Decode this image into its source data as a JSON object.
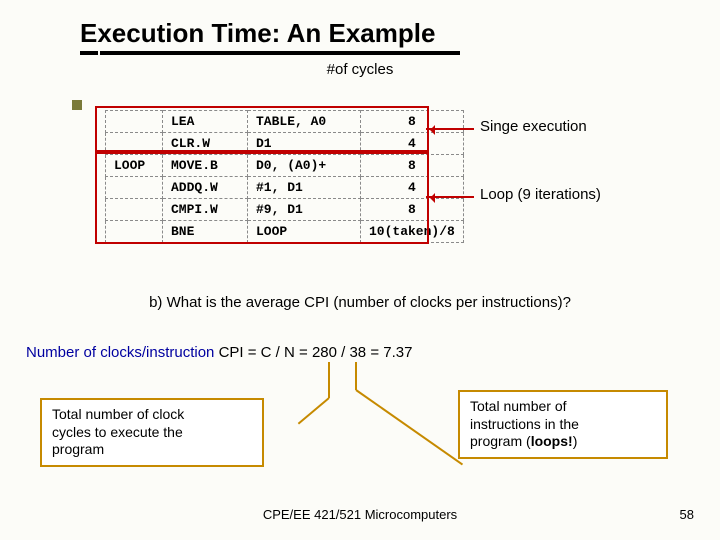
{
  "title": "Execution Time: An Example",
  "cycles_label": "#of cycles",
  "rows": [
    {
      "label": "",
      "mnemonic": "LEA",
      "operands": "TABLE, A0",
      "cycles": "8"
    },
    {
      "label": "",
      "mnemonic": "CLR.W",
      "operands": "D1",
      "cycles": "4"
    },
    {
      "label": "LOOP",
      "mnemonic": "MOVE.B",
      "operands": "D0, (A0)+",
      "cycles": "8"
    },
    {
      "label": "",
      "mnemonic": "ADDQ.W",
      "operands": "#1, D1",
      "cycles": "4"
    },
    {
      "label": "",
      "mnemonic": "CMPI.W",
      "operands": "#9, D1",
      "cycles": "8"
    },
    {
      "label": "",
      "mnemonic": "BNE",
      "operands": "LOOP",
      "cycles": "10(taken)/8"
    }
  ],
  "annot_single": "Singe execution",
  "annot_loop": "Loop (9 iterations)",
  "question": "b) What is the average CPI (number of clocks per instructions)?",
  "cpi_prefix": "Number of clocks/instruction ",
  "cpi_value": "CPI = C / N = 280 / 38 = 7.37",
  "callout_left_lines": [
    "Total number of clock",
    "cycles to execute the",
    "program"
  ],
  "callout_right_lines": [
    "Total number of",
    "instructions in the",
    "program (",
    "loops!",
    ")"
  ],
  "footer_left": "CPE/EE 421/521 Microcomputers",
  "footer_right": "58"
}
